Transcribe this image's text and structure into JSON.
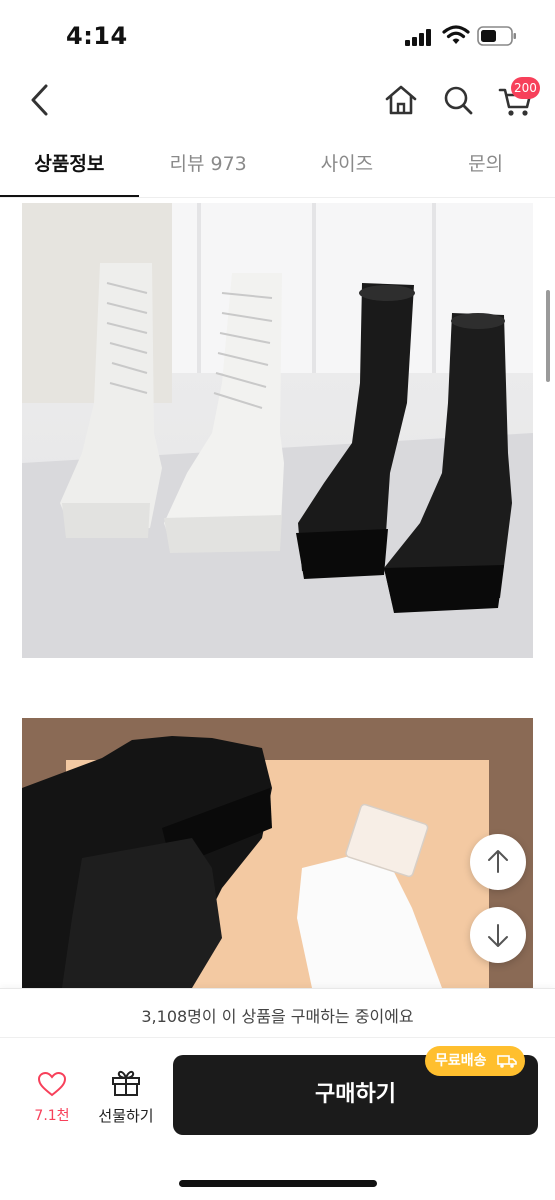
{
  "status_bar": {
    "time": "4:14"
  },
  "nav": {
    "cart_count": "200"
  },
  "tabs": [
    {
      "label": "상품정보",
      "active": true
    },
    {
      "label": "리뷰 973",
      "active": false
    },
    {
      "label": "사이즈",
      "active": false
    },
    {
      "label": "문의",
      "active": false
    }
  ],
  "product_images": [
    {
      "subject": "white and black lace-up combat boots on white table"
    },
    {
      "subject": "black and white combat boots on beige and orange background"
    }
  ],
  "bottom_bar": {
    "buying_now": "3,108명이 이 상품을 구매하는 중이에요",
    "like_count": "7.1천",
    "gift_label": "선물하기",
    "buy_label": "구매하기",
    "shipping_badge": "무료배송"
  },
  "colors": {
    "accent": "#f7405a",
    "buy_button": "#1b1b1b",
    "badge": "#ffbf2e"
  }
}
